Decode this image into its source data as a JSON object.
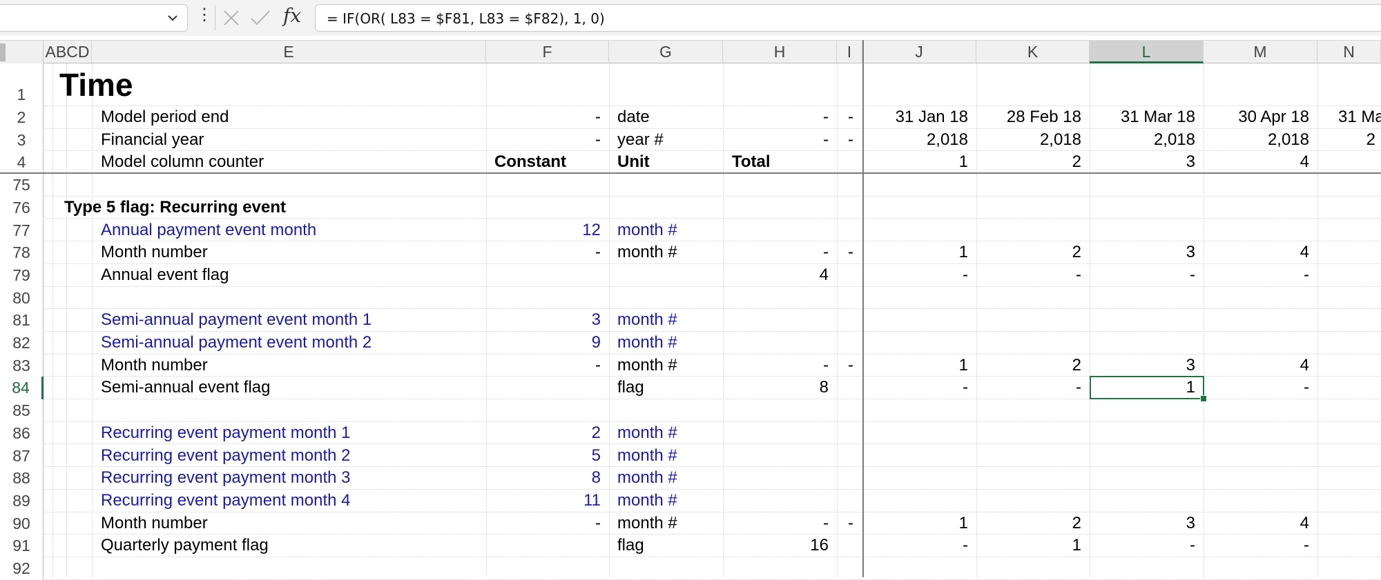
{
  "formula_bar": {
    "name_box": "",
    "formula": "= IF(OR( L83 = $F81, L83 = $F82), 1, 0)"
  },
  "columns": [
    "ABCD",
    "E",
    "F",
    "G",
    "H",
    "I",
    "J",
    "K",
    "L",
    "M",
    "N"
  ],
  "selected_column": "L",
  "selected_row": "84",
  "rows": [
    {
      "n": "1",
      "E": "Time",
      "title": true
    },
    {
      "n": "2",
      "E": "Model period end",
      "F": "-",
      "G": "date",
      "H": "-",
      "I": "-",
      "J": "31 Jan 18",
      "K": "28 Feb 18",
      "L": "31 Mar 18",
      "M": "30 Apr 18",
      "N": "31 Ma"
    },
    {
      "n": "3",
      "E": "Financial year",
      "F": "-",
      "G": "year #",
      "H": "-",
      "I": "-",
      "J": "2,018",
      "K": "2,018",
      "L": "2,018",
      "M": "2,018",
      "N": "2"
    },
    {
      "n": "4",
      "E": "Model column counter",
      "F": "Constant",
      "G": "Unit",
      "H": "Total",
      "J": "1",
      "K": "2",
      "L": "3",
      "M": "4"
    },
    {
      "n": "75"
    },
    {
      "n": "76",
      "D": "Type 5 flag: Recurring event"
    },
    {
      "n": "77",
      "E": "Annual payment event month",
      "F": "12",
      "G": "month #",
      "blue": true
    },
    {
      "n": "78",
      "E": "Month number",
      "F": "-",
      "G": "month #",
      "H": "-",
      "I": "-",
      "J": "1",
      "K": "2",
      "L": "3",
      "M": "4"
    },
    {
      "n": "79",
      "E": "Annual event flag",
      "H": "4",
      "J": "-",
      "K": "-",
      "L": "-",
      "M": "-"
    },
    {
      "n": "80"
    },
    {
      "n": "81",
      "E": "Semi-annual payment event month 1",
      "F": "3",
      "G": "month #",
      "blue": true
    },
    {
      "n": "82",
      "E": "Semi-annual payment event month 2",
      "F": "9",
      "G": "month #",
      "blue": true
    },
    {
      "n": "83",
      "E": "Month number",
      "F": "-",
      "G": "month #",
      "H": "-",
      "I": "-",
      "J": "1",
      "K": "2",
      "L": "3",
      "M": "4"
    },
    {
      "n": "84",
      "E": "Semi-annual event flag",
      "G": "flag",
      "H": "8",
      "J": "-",
      "K": "-",
      "L": "1",
      "M": "-"
    },
    {
      "n": "85"
    },
    {
      "n": "86",
      "E": "Recurring event payment month 1",
      "F": "2",
      "G": "month #",
      "blue": true
    },
    {
      "n": "87",
      "E": "Recurring event payment month 2",
      "F": "5",
      "G": "month #",
      "blue": true
    },
    {
      "n": "88",
      "E": "Recurring event payment month 3",
      "F": "8",
      "G": "month #",
      "blue": true
    },
    {
      "n": "89",
      "E": "Recurring event payment month 4",
      "F": "11",
      "G": "month #",
      "blue": true
    },
    {
      "n": "90",
      "E": "Month number",
      "F": "-",
      "G": "month #",
      "H": "-",
      "I": "-",
      "J": "1",
      "K": "2",
      "L": "3",
      "M": "4"
    },
    {
      "n": "91",
      "E": "Quarterly payment flag",
      "G": "flag",
      "H": "16",
      "J": "-",
      "K": "1",
      "L": "-",
      "M": "-"
    },
    {
      "n": "92"
    }
  ]
}
